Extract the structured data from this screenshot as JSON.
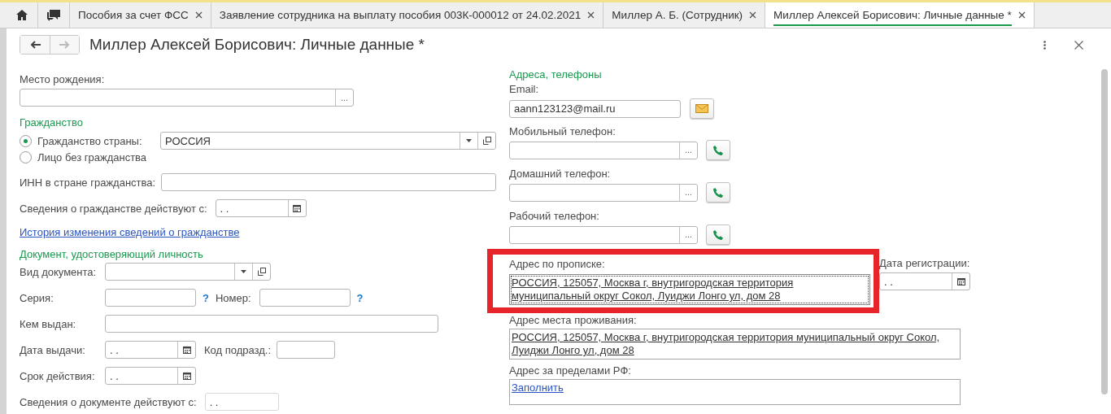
{
  "tabs": [
    {
      "label": "Пособия за счет ФСС",
      "selected": false
    },
    {
      "label": "Заявление сотрудника на выплату пособия 003К-000012 от 24.02.2021",
      "selected": false
    },
    {
      "label": "Миллер А. Б. (Сотрудник)",
      "selected": false
    },
    {
      "label": "Миллер Алексей Борисович: Личные данные *",
      "selected": true
    }
  ],
  "form": {
    "title": "Миллер Алексей Борисович: Личные данные *"
  },
  "birthplace": {
    "label": "Место рождения:",
    "select_button": "..."
  },
  "citizenship": {
    "heading": "Гражданство",
    "options": [
      {
        "label": "Гражданство страны:",
        "selected": true
      },
      {
        "label": "Лицо без гражданства",
        "selected": false
      }
    ],
    "country": "РОССИЯ",
    "inn_label": "ИНН в стране гражданства:",
    "since_label": "Сведения о гражданстве действуют с:",
    "since_value": ". .",
    "history_link": "История изменения сведений о гражданстве"
  },
  "document": {
    "heading": "Документ, удостоверяющий личность",
    "type_label": "Вид документа:",
    "series_label": "Серия:",
    "series_hint": "?",
    "number_label": "Номер:",
    "number_hint": "?",
    "issuer_label": "Кем выдан:",
    "issue_date_label": "Дата выдачи:",
    "issue_date": ". .",
    "code_label": "Код подразд.:",
    "valid_label": "Срок действия:",
    "valid_date": ". .",
    "since_label": "Сведения о документе действуют с:",
    "since_value": ". ."
  },
  "contacts": {
    "heading": "Адреса, телефоны",
    "email_label": "Email:",
    "email": "aann123123@mail.ru",
    "phones": [
      {
        "label": "Мобильный телефон:",
        "select_button": "..."
      },
      {
        "label": "Домашний телефон:",
        "select_button": "..."
      },
      {
        "label": "Рабочий телефон:",
        "select_button": "..."
      }
    ],
    "registration_label": "Адрес по прописке:",
    "registration_address": "РОССИЯ, 125057, Москва г, внутригородская территория муниципальный округ Сокол, Луиджи Лонго ул, дом 28",
    "registration_highlighted": true,
    "registration_date_label": "Дата регистрации:",
    "registration_date": ". .",
    "residence_label": "Адрес места проживания:",
    "residence_address": "РОССИЯ, 125057, Москва г, внутригородская территория муниципальный округ Сокол, Луиджи Лонго ул, дом 28",
    "abroad_label": "Адрес за пределами РФ:",
    "abroad_link": "Заполнить"
  }
}
